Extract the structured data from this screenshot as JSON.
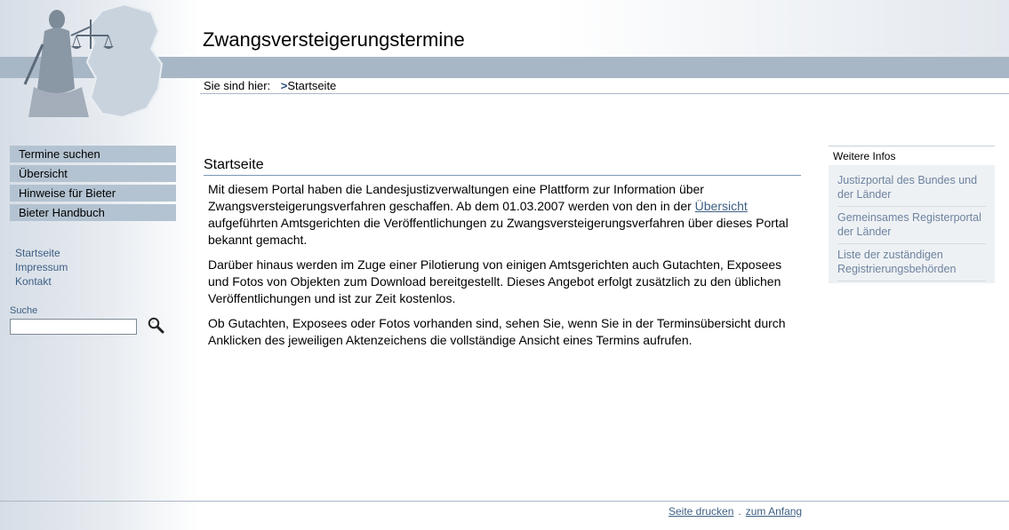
{
  "header": {
    "site_title": "Zwangsversteigerungstermine",
    "breadcrumb_prefix": "Sie sind hier:",
    "breadcrumb_arrow": ">",
    "breadcrumb_current": "Startseite"
  },
  "nav": {
    "main": [
      {
        "label": "Termine suchen"
      },
      {
        "label": "Übersicht"
      },
      {
        "label": "Hinweise für Bieter"
      },
      {
        "label": "Bieter Handbuch"
      }
    ],
    "meta": [
      {
        "label": "Startseite"
      },
      {
        "label": "Impressum"
      },
      {
        "label": "Kontakt"
      }
    ]
  },
  "search": {
    "label": "Suche",
    "value": ""
  },
  "content": {
    "heading": "Startseite",
    "p1_before": "Mit diesem Portal haben die Landesjustizverwaltungen eine Plattform zur Information über Zwangsversteigerungsverfahren geschaffen. Ab dem 01.03.2007 werden von den in der ",
    "p1_link": "Übersicht",
    "p1_after": " aufgeführten Amtsgerichten die Veröffentlichungen zu Zwangsversteigerungsverfahren über dieses Portal bekannt gemacht.",
    "p2": "Darüber hinaus werden im Zuge einer Pilotierung von einigen Amtsgerichten auch Gutachten, Exposees und Fotos von Objekten zum Download bereitgestellt. Dieses Angebot erfolgt zusätzlich zu den üblichen Veröffentlichungen und ist zur Zeit kostenlos.",
    "p3": "Ob Gutachten, Exposees oder Fotos vorhanden sind, sehen Sie, wenn Sie in der Terminsübersicht durch Anklicken des jeweiligen Aktenzeichens die vollständige Ansicht eines Termins aufrufen."
  },
  "sidebar": {
    "heading": "Weitere Infos",
    "links": [
      {
        "label": "Justizportal des Bundes und der Länder"
      },
      {
        "label": "Gemeinsames Registerportal der Länder"
      },
      {
        "label": "Liste der zuständigen Registrierungsbehörden"
      }
    ]
  },
  "footer": {
    "print_label": "Seite drucken",
    "separator": ".",
    "top_label": "zum Anfang"
  },
  "icons": {
    "search": "magnifier-icon",
    "logo": "justitia-logo"
  },
  "colors": {
    "band": "#a8b7c6",
    "nav_item": "#b4c3d1",
    "link": "#3d5f84",
    "sidebar_link": "#6d83a0"
  }
}
